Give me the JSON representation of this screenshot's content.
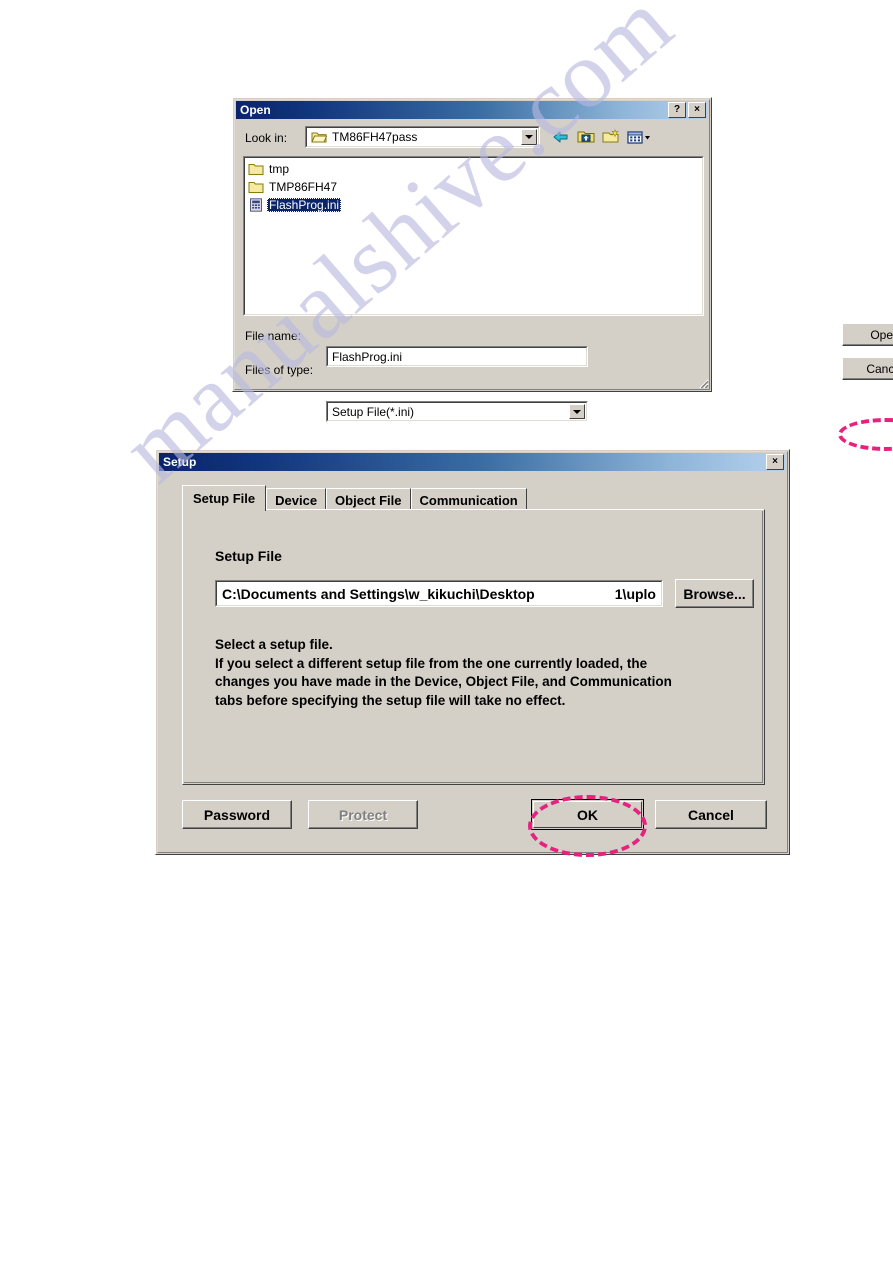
{
  "page": {
    "watermark": "manualshive.com",
    "background": "#ffffff",
    "accent_highlight_color": "#e8217f",
    "dialog_face_color": "#d4d0c8",
    "titlebar_color": "#0a246a"
  },
  "open_dialog": {
    "title": "Open",
    "titlebar_buttons": [
      {
        "name": "help",
        "glyph": "?"
      },
      {
        "name": "close",
        "glyph": "×"
      }
    ],
    "lookin_label": "Look in:",
    "lookin_value": "TM86FH47pass",
    "toolbar_icons": [
      "back-arrow-icon",
      "up-one-level-icon",
      "new-folder-icon",
      "views-icon"
    ],
    "files": [
      {
        "name": "tmp",
        "type": "folder",
        "selected": false
      },
      {
        "name": "TMP86FH47",
        "type": "folder",
        "selected": false
      },
      {
        "name": "FlashProg.ini",
        "type": "ini-file",
        "selected": true
      }
    ],
    "filename_label": "File name:",
    "filename_value": "FlashProg.ini",
    "filetype_label": "Files of type:",
    "filetype_value": "Setup File(*.ini)",
    "open_button": "Open",
    "cancel_button": "Cancel",
    "highlighted_control": "open-button"
  },
  "setup_dialog": {
    "title": "Setup",
    "close_glyph": "×",
    "tabs": [
      {
        "label": "Setup File",
        "active": true
      },
      {
        "label": "Device",
        "active": false
      },
      {
        "label": "Object File",
        "active": false
      },
      {
        "label": "Communication",
        "active": false
      }
    ],
    "group_label": "Setup File",
    "path_value_left": "C:\\Documents and Settings\\w_kikuchi\\Desktop",
    "path_value_right": "1\\uplo",
    "browse_button": "Browse...",
    "description": "Select a setup file.\nIf you select a different setup file from the one currently loaded, the\nchanges you have made in the Device, Object File, and Communication\ntabs before specifying the setup file will take no effect.",
    "buttons": {
      "password": "Password",
      "protect": "Protect",
      "protect_disabled": true,
      "ok": "OK",
      "cancel": "Cancel"
    },
    "highlighted_control": "ok-button"
  }
}
